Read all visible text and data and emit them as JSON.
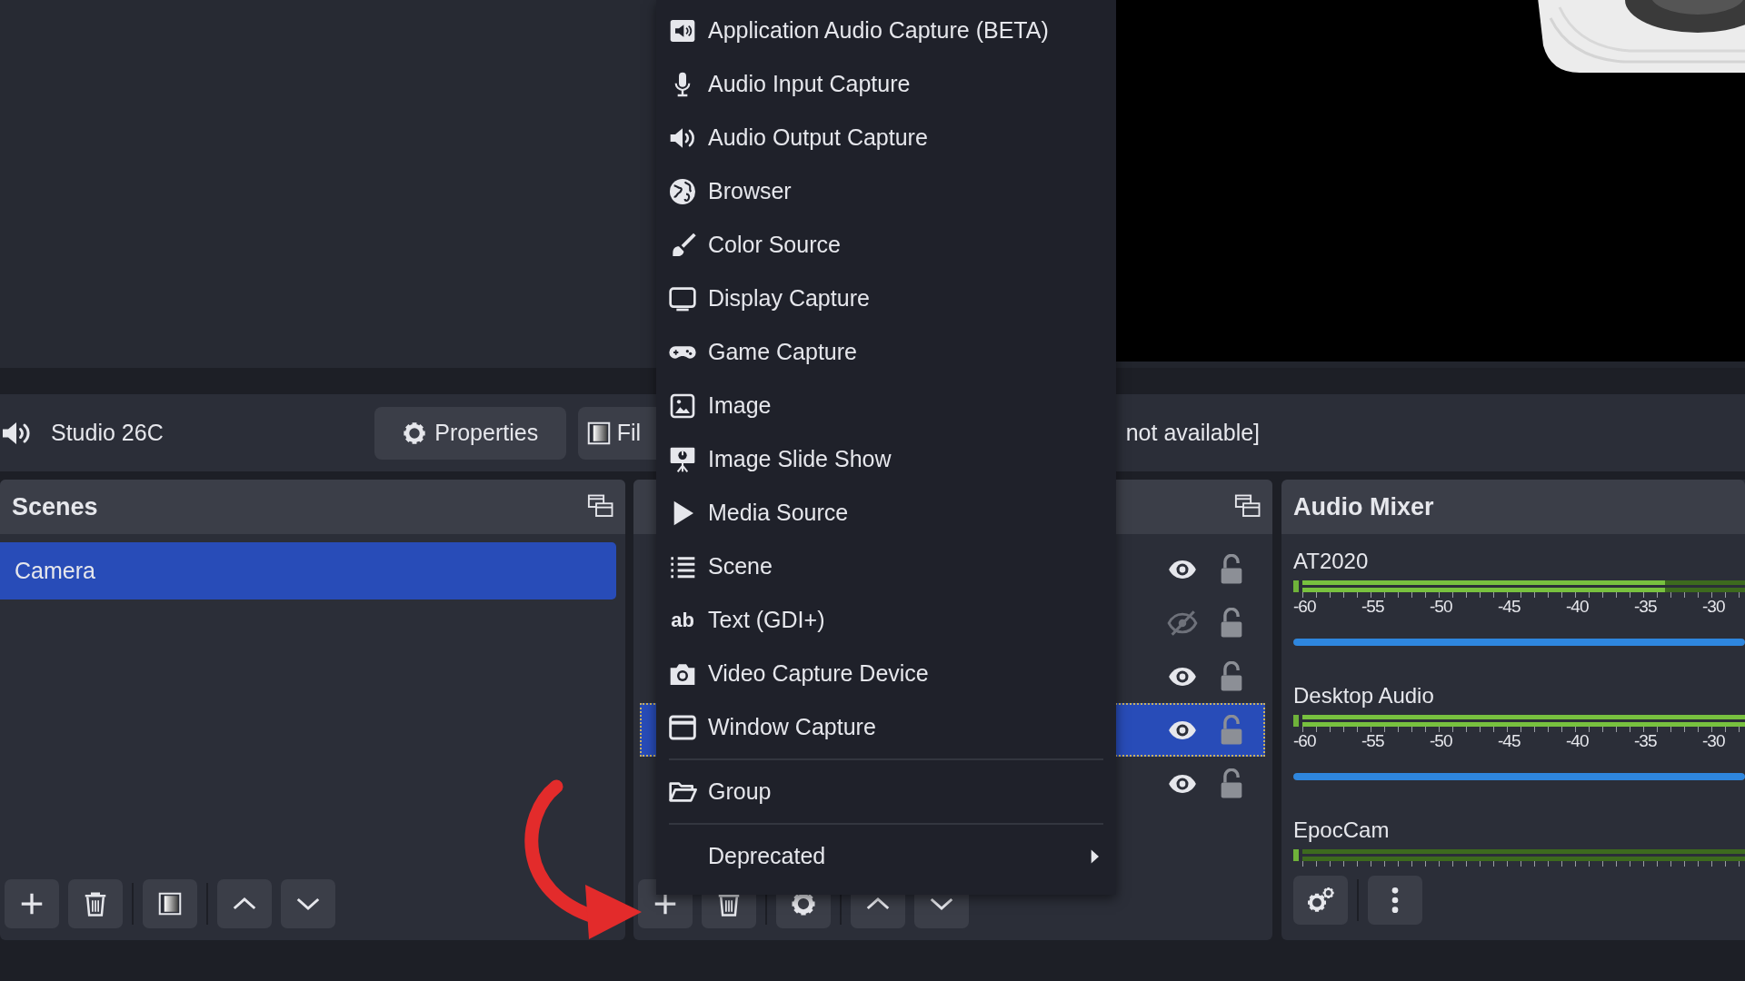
{
  "context_bar": {
    "source_name": "Studio 26C",
    "buttons": [
      "Properties",
      "Fil"
    ],
    "status": "not available]"
  },
  "scenes": {
    "title": "Scenes",
    "items": [
      {
        "name": "Camera",
        "selected": true
      }
    ]
  },
  "sources": {
    "rows": [
      {
        "visible": true,
        "locked": false,
        "selected": false
      },
      {
        "visible": false,
        "locked": false,
        "selected": false
      },
      {
        "visible": true,
        "locked": false,
        "selected": false
      },
      {
        "visible": true,
        "locked": false,
        "selected": true
      },
      {
        "visible": true,
        "locked": false,
        "selected": false
      }
    ]
  },
  "add_source_menu": {
    "items": [
      {
        "kind": "item",
        "label": "Application Audio Capture (BETA)"
      },
      {
        "kind": "item",
        "label": "Audio Input Capture"
      },
      {
        "kind": "item",
        "label": "Audio Output Capture"
      },
      {
        "kind": "item",
        "label": "Browser"
      },
      {
        "kind": "item",
        "label": "Color Source"
      },
      {
        "kind": "item",
        "label": "Display Capture"
      },
      {
        "kind": "item",
        "label": "Game Capture"
      },
      {
        "kind": "item",
        "label": "Image"
      },
      {
        "kind": "item",
        "label": "Image Slide Show"
      },
      {
        "kind": "item",
        "label": "Media Source"
      },
      {
        "kind": "item",
        "label": "Scene"
      },
      {
        "kind": "item",
        "label": "Text (GDI+)",
        "glyph": "ab"
      },
      {
        "kind": "item",
        "label": "Video Capture Device"
      },
      {
        "kind": "item",
        "label": "Window Capture"
      },
      {
        "kind": "separator"
      },
      {
        "kind": "item",
        "label": "Group"
      },
      {
        "kind": "separator"
      },
      {
        "kind": "submenu",
        "label": "Deprecated"
      }
    ]
  },
  "audio_mixer": {
    "title": "Audio Mixer",
    "channels": [
      {
        "name": "AT2020",
        "level": 0.82,
        "scale": [
          "-60",
          "-55",
          "-50",
          "-45",
          "-40",
          "-35",
          "-30"
        ],
        "volume": {
          "level": 1
        }
      },
      {
        "name": "Desktop Audio",
        "level": 1,
        "scale": [
          "-60",
          "-55",
          "-50",
          "-45",
          "-40",
          "-35",
          "-30"
        ],
        "volume": {
          "level": 1
        }
      },
      {
        "name": "EpocCam",
        "level": 0
      }
    ]
  }
}
